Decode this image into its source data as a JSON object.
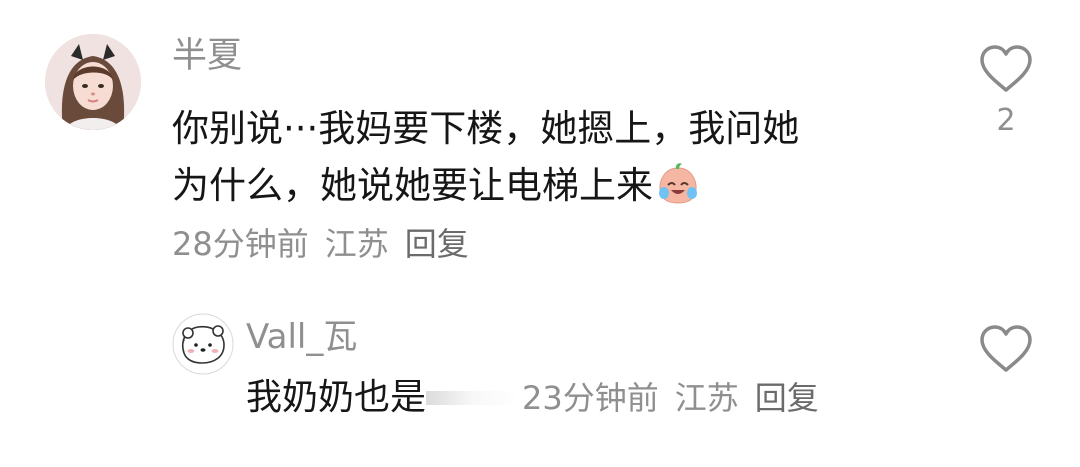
{
  "comment": {
    "username": "半夏",
    "text_line1": "你别说···我妈要下楼，她摁上，我问她",
    "text_line2": "为什么，她说她要让电梯上来",
    "emoji": "crying-laughing-emoji",
    "time": "28分钟前",
    "location": "江苏",
    "reply_label": "回复",
    "like_count": "2"
  },
  "reply": {
    "username": "Vall_瓦",
    "text": "我奶奶也是",
    "time": "23分钟前",
    "location": "江苏",
    "reply_label": "回复"
  },
  "icons": {
    "like": "heart-outline-icon"
  },
  "colors": {
    "text_primary": "#161616",
    "text_secondary": "#8f8f8f",
    "heart_stroke": "#8a8a8a"
  }
}
